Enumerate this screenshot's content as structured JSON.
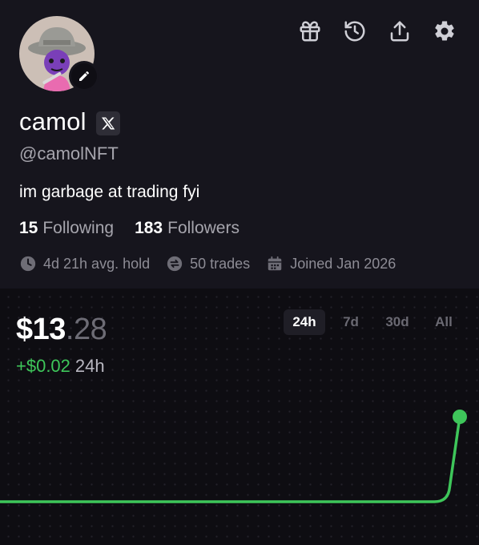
{
  "profile": {
    "name": "camol",
    "handle": "@camolNFT",
    "bio": "im garbage at trading fyi",
    "following_count": "15",
    "following_label": "Following",
    "followers_count": "183",
    "followers_label": "Followers",
    "stats": {
      "avg_hold": "4d 21h avg. hold",
      "trades": "50 trades",
      "joined": "Joined Jan 2026"
    },
    "social_icon": "x-logo-icon"
  },
  "top_icons": [
    "gift-icon",
    "history-icon",
    "share-icon",
    "gear-icon"
  ],
  "portfolio": {
    "price_main": "$13",
    "price_cents": ".28",
    "change_value": "+$0.02",
    "change_period": "24h",
    "ranges": [
      {
        "label": "24h",
        "active": true
      },
      {
        "label": "7d",
        "active": false
      },
      {
        "label": "30d",
        "active": false
      },
      {
        "label": "All",
        "active": false
      }
    ]
  },
  "colors": {
    "background": "#16151d",
    "chart_background": "#0e0d12",
    "positive": "#3ec65a",
    "muted_text": "#a6a5ad"
  },
  "chart_data": {
    "type": "line",
    "series": [
      {
        "values": [
          13.26,
          13.26,
          13.26,
          13.26,
          13.26,
          13.26,
          13.26,
          13.26,
          13.26,
          13.26,
          13.28
        ]
      }
    ],
    "x": [
      0,
      1,
      2,
      3,
      4,
      5,
      6,
      7,
      8,
      9,
      10
    ],
    "ylim": [
      13.26,
      13.28
    ],
    "grid": false,
    "endpoint_marker": true
  }
}
